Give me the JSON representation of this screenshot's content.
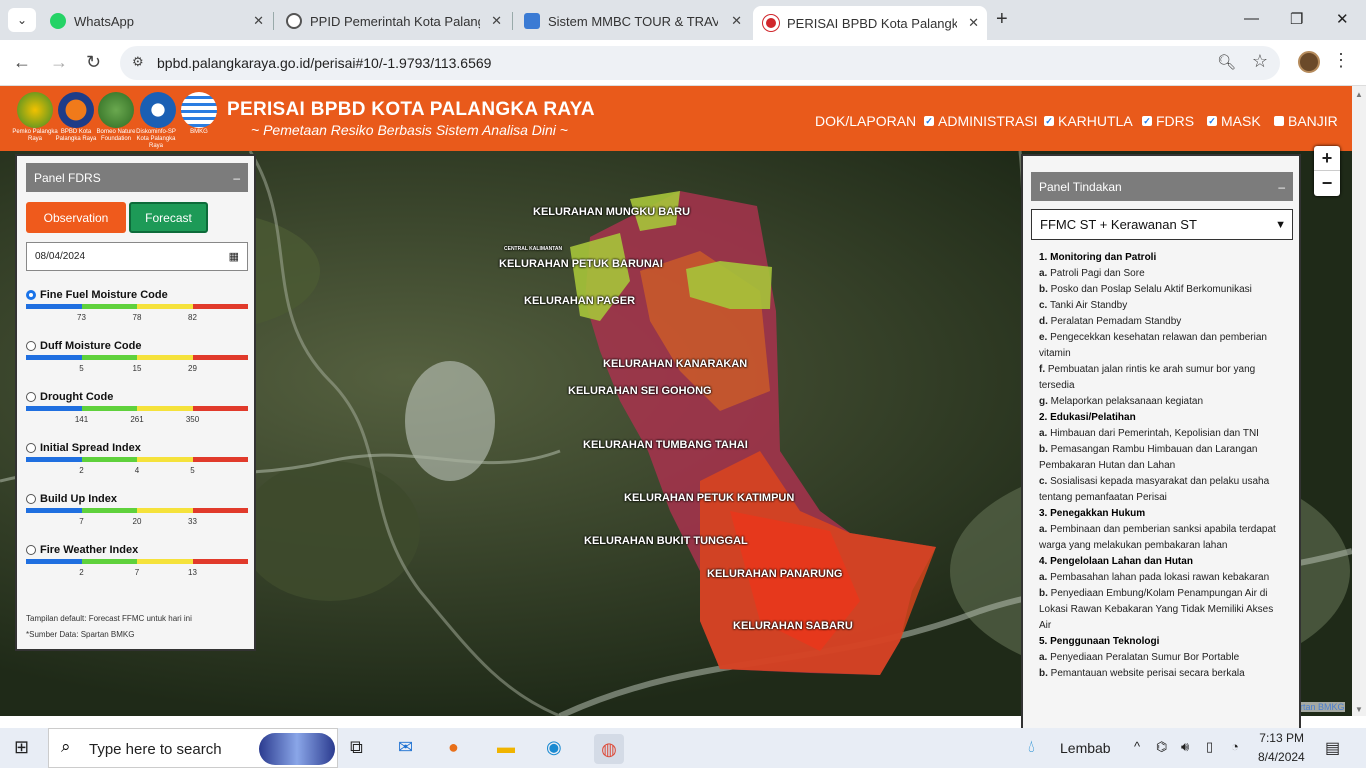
{
  "browser": {
    "tabs": [
      {
        "label": "WhatsApp",
        "icon": "whatsapp-icon"
      },
      {
        "label": "PPID Pemerintah Kota Palangka",
        "icon": "globe-icon"
      },
      {
        "label": "Sistem MMBC TOUR & TRAVEL",
        "icon": "site-icon"
      },
      {
        "label": "PERISAI BPBD Kota Palangka Ra",
        "icon": "perisai-icon"
      }
    ],
    "url": "bpbd.palangkaraya.go.id/perisai#10/-1.9793/113.6569"
  },
  "header": {
    "title": "PERISAI BPBD KOTA PALANGKA RAYA",
    "subtitle": "~ Pemetaan Resiko Berbasis Sistem Analisa Dini ~",
    "logos": [
      {
        "caption": "Pemko Palangka Raya"
      },
      {
        "caption": "BPBD Kota Palangka Raya"
      },
      {
        "caption": "Borneo Nature Foundation"
      },
      {
        "caption": "Diskominfo-SP Kota Palangka Raya"
      },
      {
        "caption": "BMKG"
      }
    ],
    "menu": [
      {
        "label": "DOK/LAPORAN",
        "checkbox": false
      },
      {
        "label": "ADMINISTRASI",
        "checkbox": true,
        "checked": true
      },
      {
        "label": "KARHUTLA",
        "checkbox": true,
        "checked": true
      },
      {
        "label": "FDRS",
        "checkbox": true,
        "checked": true
      },
      {
        "label": "MASK",
        "checkbox": true,
        "checked": true
      },
      {
        "label": "BANJIR",
        "checkbox": true,
        "checked": false
      }
    ]
  },
  "map": {
    "kelurahan": [
      "KELURAHAN MUNGKU BARU",
      "KELURAHAN PETUK BARUNAI",
      "KELURAHAN PAGER",
      "KELURAHAN KANARAKAN",
      "KELURAHAN SEI GOHONG",
      "KELURAHAN TUMBANG TAHAI",
      "KELURAHAN PETUK KATIMPUN",
      "KELURAHAN BUKIT TUNGGAL",
      "KELURAHAN PANARUNG",
      "KELURAHAN SABARU"
    ],
    "small_label": "CENTRAL KALIMANTAN",
    "zoom_in": "+",
    "zoom_out": "−",
    "attribution": "rtan BMKG"
  },
  "left_panel": {
    "title": "Panel FDRS",
    "minimize": "–",
    "observation_label": "Observation",
    "forecast_label": "Forecast",
    "date": "08/04/2024",
    "indices": [
      {
        "name": "Fine Fuel Moisture Code",
        "ticks": [
          "73",
          "78",
          "82"
        ],
        "selected": true
      },
      {
        "name": "Duff Moisture Code",
        "ticks": [
          "5",
          "15",
          "29"
        ],
        "selected": false
      },
      {
        "name": "Drought Code",
        "ticks": [
          "141",
          "261",
          "350"
        ],
        "selected": false
      },
      {
        "name": "Initial Spread Index",
        "ticks": [
          "2",
          "4",
          "5"
        ],
        "selected": false
      },
      {
        "name": "Build Up Index",
        "ticks": [
          "7",
          "20",
          "33"
        ],
        "selected": false
      },
      {
        "name": "Fire Weather Index",
        "ticks": [
          "2",
          "7",
          "13"
        ],
        "selected": false
      }
    ],
    "note1": "Tampilan default: Forecast FFMC untuk hari ini",
    "note2": "*Sumber Data: Spartan BMKG",
    "colors": {
      "blue": "#1f6fe0",
      "green": "#5fd13c",
      "yellow": "#f5e23b",
      "red": "#e13a2b",
      "observation": "#ef5a1c",
      "forecast": "#1d9a57"
    }
  },
  "right_panel": {
    "title": "Panel Tindakan",
    "minimize": "–",
    "select_value": "FFMC ST + Kerawanan ST",
    "actions": [
      {
        "k": "1.",
        "text": "Monitoring dan Patroli",
        "h": true
      },
      {
        "k": "a.",
        "text": "Patroli Pagi dan Sore"
      },
      {
        "k": "b.",
        "text": "Posko dan Poslap Selalu Aktif Berkomunikasi"
      },
      {
        "k": "c.",
        "text": "Tanki Air Standby"
      },
      {
        "k": "d.",
        "text": "Peralatan Pemadam Standby"
      },
      {
        "k": "e.",
        "text": "Pengecekkan kesehatan relawan dan pemberian vitamin"
      },
      {
        "k": "f.",
        "text": "Pembuatan jalan rintis ke arah sumur bor yang tersedia"
      },
      {
        "k": "g.",
        "text": "Melaporkan pelaksanaan kegiatan"
      },
      {
        "k": "2.",
        "text": "Edukasi/Pelatihan",
        "h": true
      },
      {
        "k": "a.",
        "text": "Himbauan dari Pemerintah, Kepolisian dan TNI"
      },
      {
        "k": "b.",
        "text": "Pemasangan Rambu Himbauan dan Larangan Pembakaran Hutan dan Lahan"
      },
      {
        "k": "c.",
        "text": "Sosialisasi kepada masyarakat dan pelaku usaha tentang pemanfaatan Perisai"
      },
      {
        "k": "3.",
        "text": "Penegakkan Hukum",
        "h": true
      },
      {
        "k": "a.",
        "text": "Pembinaan dan pemberian sanksi apabila terdapat warga yang melakukan pembakaran lahan"
      },
      {
        "k": "4.",
        "text": "Pengelolaan Lahan dan Hutan",
        "h": true
      },
      {
        "k": "a.",
        "text": "Pembasahan lahan pada lokasi rawan kebakaran"
      },
      {
        "k": "b.",
        "text": "Penyediaan Embung/Kolam Penampungan Air di Lokasi Rawan Kebakaran Yang Tidak Memiliki Akses Air"
      },
      {
        "k": "5.",
        "text": "Penggunaan Teknologi",
        "h": true
      },
      {
        "k": "a.",
        "text": "Penyediaan Peralatan Sumur Bor Portable"
      },
      {
        "k": "b.",
        "text": "Pemantauan website perisai secara berkala"
      }
    ]
  },
  "taskbar": {
    "search_placeholder": "Type here to search",
    "weather": "Lembab",
    "time": "7:13 PM",
    "date": "8/4/2024"
  }
}
